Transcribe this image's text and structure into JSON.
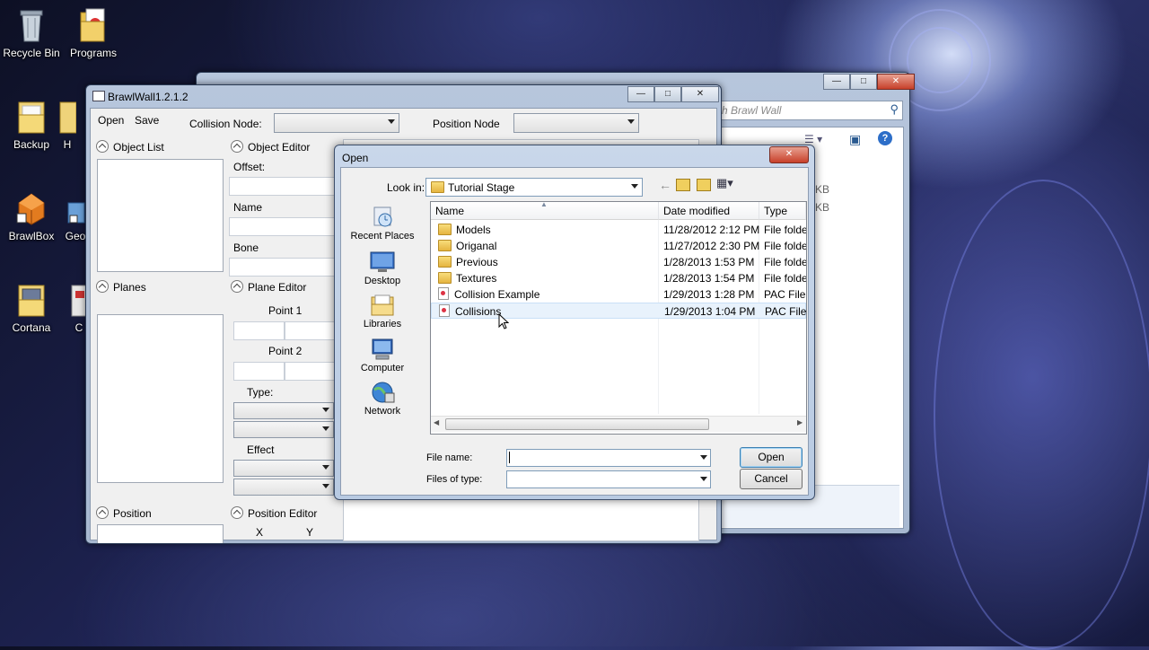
{
  "desktop": {
    "icons": [
      {
        "label": "Recycle Bin",
        "icon": "recycle-bin-icon"
      },
      {
        "label": "Programs",
        "icon": "programs-folder-icon"
      },
      {
        "label": "Backup",
        "icon": "folder-icon"
      },
      {
        "label": "H",
        "icon": "folder-icon"
      },
      {
        "label": "BrawlBox",
        "icon": "brawlbox-icon"
      },
      {
        "label": "Geo",
        "icon": "shortcut-icon"
      },
      {
        "label": "Cortana",
        "icon": "folder-icon"
      },
      {
        "label": "C",
        "icon": "folder-icon"
      }
    ]
  },
  "explorer": {
    "search_placeholder": "rch Brawl Wall",
    "size_col_1": "KB",
    "size_col_2": "KB"
  },
  "brawlwall": {
    "title": "BrawlWall1.2.1.2",
    "menu": {
      "open": "Open",
      "save": "Save"
    },
    "collision_node_label": "Collision Node:",
    "position_node_label": "Position Node",
    "object_list": "Object List",
    "object_editor": "Object Editor",
    "offset_label": "Offset:",
    "name_label": "Name",
    "bone_label": "Bone",
    "planes": "Planes",
    "plane_editor": "Plane Editor",
    "point1": "Point 1",
    "point2": "Point 2",
    "type_label": "Type:",
    "effect_label": "Effect",
    "position": "Position",
    "position_editor": "Position Editor",
    "x_label": "X",
    "y_label": "Y"
  },
  "open_dialog": {
    "title": "Open",
    "look_in_label": "Look in:",
    "look_in_value": "Tutorial Stage",
    "places": [
      "Recent Places",
      "Desktop",
      "Libraries",
      "Computer",
      "Network"
    ],
    "columns": [
      "Name",
      "Date modified",
      "Type"
    ],
    "rows": [
      {
        "name": "Models",
        "date": "11/28/2012 2:12 PM",
        "type": "File folder",
        "kind": "folder"
      },
      {
        "name": "Origanal",
        "date": "11/27/2012 2:30 PM",
        "type": "File folder",
        "kind": "folder"
      },
      {
        "name": "Previous",
        "date": "1/28/2013 1:53 PM",
        "type": "File folder",
        "kind": "folder"
      },
      {
        "name": "Textures",
        "date": "1/28/2013 1:54 PM",
        "type": "File folder",
        "kind": "folder"
      },
      {
        "name": "Collision Example",
        "date": "1/29/2013 1:28 PM",
        "type": "PAC File",
        "kind": "file"
      },
      {
        "name": "Collisions",
        "date": "1/29/2013 1:04 PM",
        "type": "PAC File",
        "kind": "file"
      }
    ],
    "file_name_label": "File name:",
    "file_name_value": "",
    "files_of_type_label": "Files of type:",
    "files_of_type_value": "",
    "open_button": "Open",
    "cancel_button": "Cancel"
  }
}
